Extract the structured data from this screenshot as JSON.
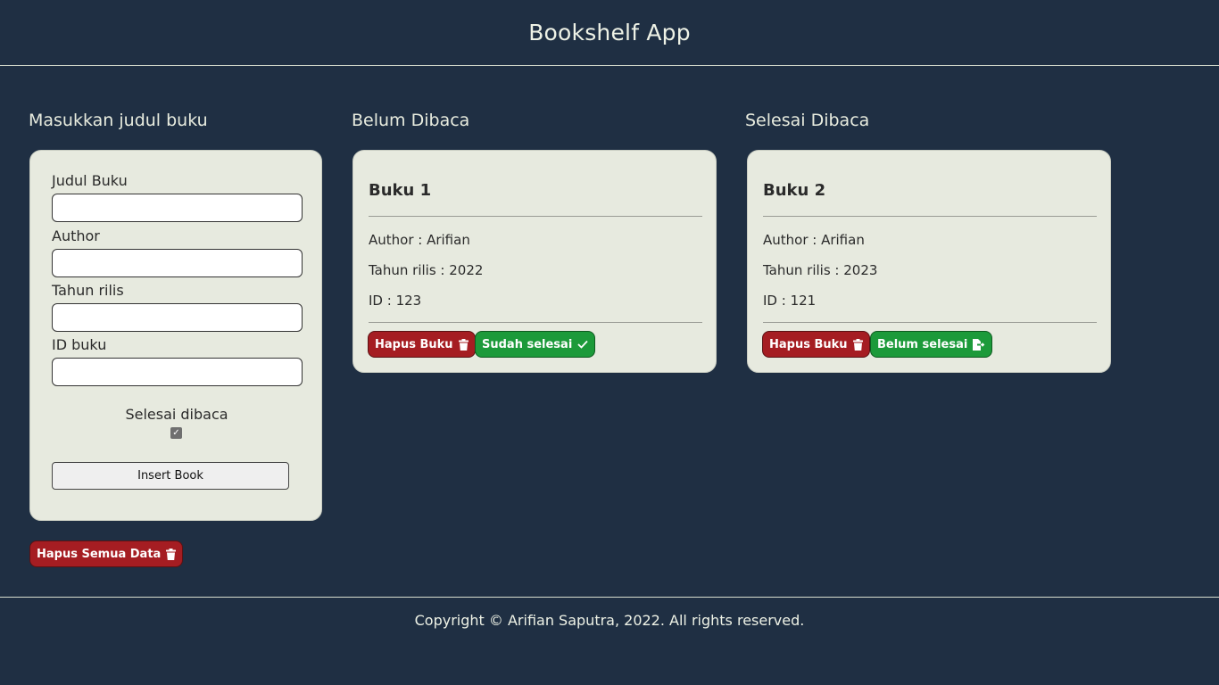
{
  "header": {
    "title": "Bookshelf App"
  },
  "form": {
    "heading": "Masukkan judul buku",
    "fields": [
      {
        "label": "Judul Buku",
        "value": ""
      },
      {
        "label": "Author",
        "value": ""
      },
      {
        "label": "Tahun rilis",
        "value": ""
      },
      {
        "label": "ID buku",
        "value": ""
      }
    ],
    "checkbox_label": "Selesai dibaca",
    "checkbox_checked": true,
    "submit_label": "Insert Book"
  },
  "unread": {
    "heading": "Belum Dibaca",
    "book": {
      "title": "Buku 1",
      "author": "Author : Arifian",
      "year": "Tahun rilis : 2022",
      "id": "ID : 123",
      "delete_label": "Hapus Buku",
      "toggle_label": "Sudah selesai"
    }
  },
  "read": {
    "heading": "Selesai Dibaca",
    "book": {
      "title": "Buku 2",
      "author": "Author : Arifian",
      "year": "Tahun rilis : 2023",
      "id": "ID : 121",
      "delete_label": "Hapus Buku",
      "toggle_label": "Belum selesai"
    }
  },
  "clear_all_label": "Hapus Semua Data",
  "footer": {
    "text": "Copyright © Arifian Saputra, 2022. All rights reserved."
  },
  "colors": {
    "background": "#1f2f43",
    "panel": "#e7eadf",
    "danger": "#a51d22",
    "success": "#1c9a3a"
  }
}
